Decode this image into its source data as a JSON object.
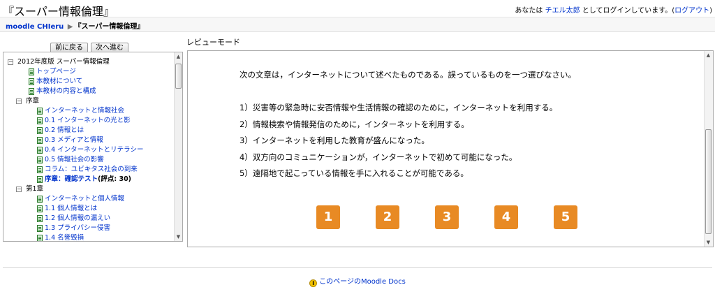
{
  "header": {
    "title": "『スーパー情報倫理』",
    "login_prefix": "あなたは",
    "user_name": "チエル太郎",
    "login_middle": "としてログインしています。",
    "logout_open": "(",
    "logout_label": "ログアウト",
    "logout_close": ")"
  },
  "breadcrumb": {
    "home": "moodle CHIeru",
    "separator": "▶",
    "current": "『スーパー情報倫理』"
  },
  "nav": {
    "prev_label": "前に戻る",
    "next_label": "次へ進む"
  },
  "review_mode_label": "レビューモード",
  "toc": [
    {
      "label": "2012年度版 スーパー情報倫理",
      "kind": "folder",
      "indent": 0
    },
    {
      "label": "トップページ",
      "kind": "link",
      "indent": 1
    },
    {
      "label": "本教材について",
      "kind": "link",
      "indent": 1
    },
    {
      "label": "本教材の内容と構成",
      "kind": "link",
      "indent": 1
    },
    {
      "label": "序章",
      "kind": "folder",
      "indent": 1
    },
    {
      "label": "インターネットと情報社会",
      "kind": "link",
      "indent": 2
    },
    {
      "label": "0.1 インターネットの光と影",
      "kind": "link",
      "indent": 2
    },
    {
      "label": "0.2 情報とは",
      "kind": "link",
      "indent": 2
    },
    {
      "label": "0.3 メディアと情報",
      "kind": "link",
      "indent": 2
    },
    {
      "label": "0.4 インターネットとリテラシー",
      "kind": "link",
      "indent": 2
    },
    {
      "label": "0.5 情報社会の影響",
      "kind": "link",
      "indent": 2
    },
    {
      "label": "コラム：ユビキタス社会の到来",
      "kind": "link",
      "indent": 2
    },
    {
      "label": "序章：確認テスト",
      "score": "(評点: 30)",
      "kind": "current",
      "indent": 2
    },
    {
      "label": "第1章",
      "kind": "folder",
      "indent": 1
    },
    {
      "label": "インターネットと個人情報",
      "kind": "link",
      "indent": 2
    },
    {
      "label": "1.1 個人情報とは",
      "kind": "link",
      "indent": 2
    },
    {
      "label": "1.2 個人情報の漏えい",
      "kind": "link",
      "indent": 2
    },
    {
      "label": "1.3 プライバシー侵害",
      "kind": "link",
      "indent": 2
    },
    {
      "label": "1.4 名誉毀損",
      "kind": "link",
      "indent": 2
    }
  ],
  "question": {
    "prompt": "次の文章は，インターネットについて述べたものである。誤っているものを一つ選びなさい。",
    "options": [
      "1）災害等の緊急時に安否情報や生活情報の確認のために，インターネットを利用する。",
      "2）情報検索や情報発信のために，インターネットを利用する。",
      "3）インターネットを利用した教育が盛んになった。",
      "4）双方向のコミュニケーションが，インターネットで初めて可能になった。",
      "5）遠隔地で起こっている情報を手に入れることが可能である。"
    ],
    "answer_buttons": [
      "1",
      "2",
      "3",
      "4",
      "5"
    ]
  },
  "footer": {
    "docs_link": "このページのMoodle Docs"
  },
  "colors": {
    "link": "#0033cc",
    "answer_button": "#e88a24"
  }
}
